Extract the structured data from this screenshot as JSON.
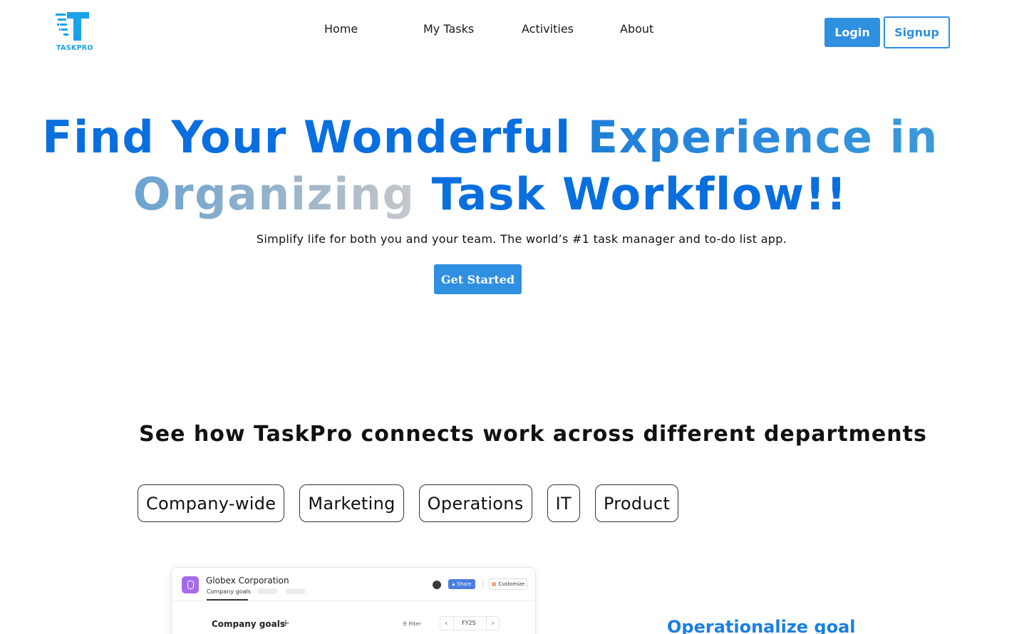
{
  "brand": {
    "name": "TASKPRO",
    "color": "#1aa3e8",
    "logo_icon": "taskpro-logo-icon"
  },
  "nav": {
    "items": [
      {
        "label": "Home"
      },
      {
        "label": "My Tasks"
      },
      {
        "label": "Activities"
      },
      {
        "label": "About"
      }
    ],
    "login_label": "Login",
    "signup_label": "Signup"
  },
  "hero": {
    "line1": {
      "part1": "Find Your Wonderful ",
      "part2": "Experience in"
    },
    "line2": {
      "part1": "Organizing",
      "part2": " Task Workflow!!"
    },
    "subtitle": "Simplify life for both you and your team. The world’s #1 task manager and to-do list app.",
    "cta_label": "Get Started"
  },
  "departments": {
    "title": "See how TaskPro connects work across different departments",
    "tabs": [
      {
        "label": "Company-wide"
      },
      {
        "label": "Marketing"
      },
      {
        "label": "Operations"
      },
      {
        "label": "IT"
      },
      {
        "label": "Product"
      }
    ]
  },
  "preview": {
    "org_name": "Globex Corporation",
    "sub_tab": "Company goals",
    "share_label": "Share",
    "customize_label": "Customize",
    "section_title": "Company goals",
    "filter_label": "Filter",
    "period_label": "FY25"
  },
  "side": {
    "heading": "Operationalize goal"
  },
  "colors": {
    "accent": "#2f8fe0",
    "hero_blue": "#0a6fde",
    "heading_blue": "#1a7fe0"
  }
}
